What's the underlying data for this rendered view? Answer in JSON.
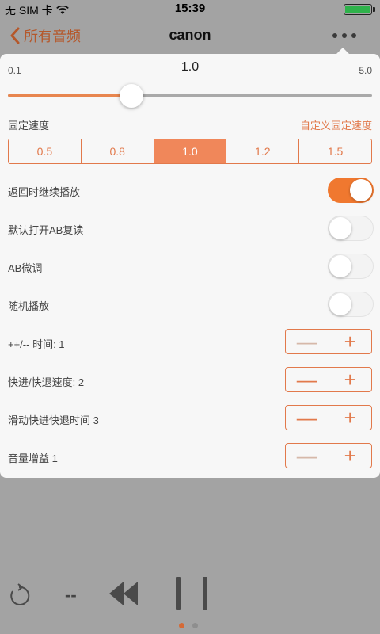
{
  "status_bar": {
    "carrier": "无 SIM 卡",
    "time": "15:39"
  },
  "nav": {
    "back_label": "所有音频",
    "title": "canon"
  },
  "speed_slider": {
    "min_label": "0.1",
    "max_label": "5.0",
    "value_label": "1.0",
    "min": 0.1,
    "max": 5.0,
    "value": 1.0
  },
  "fixed_speed": {
    "label": "固定速度",
    "custom_link": "自定义固定速度",
    "options": [
      "0.5",
      "0.8",
      "1.0",
      "1.2",
      "1.5"
    ],
    "selected": "1.0"
  },
  "toggles": [
    {
      "label": "返回时继续播放",
      "on": true
    },
    {
      "label": "默认打开AB复读",
      "on": false
    },
    {
      "label": "AB微调",
      "on": false
    },
    {
      "label": "随机播放",
      "on": false
    }
  ],
  "steppers": [
    {
      "label": "++/-- 时间: 1",
      "minus_enabled": false,
      "plus_enabled": true
    },
    {
      "label": "快进/快退速度: 2",
      "minus_enabled": true,
      "plus_enabled": true
    },
    {
      "label": "滑动快进快退时间 3",
      "minus_enabled": true,
      "plus_enabled": true
    },
    {
      "label": "音量增益 1",
      "minus_enabled": false,
      "plus_enabled": true
    }
  ],
  "stepper_symbols": {
    "minus": "—",
    "plus": "+"
  },
  "player": {
    "time_placeholder": "--",
    "page_dots": 2,
    "active_dot": 0
  },
  "colors": {
    "accent": "#e2794b",
    "toggle_on": "#f0782f",
    "segment_active": "#f0875a",
    "overlay": "#a3a3a3"
  },
  "icons": [
    "chevron-left-icon",
    "more-icon",
    "wifi-icon",
    "battery-icon",
    "repeat-icon",
    "rewind-icon",
    "pause-icon"
  ]
}
